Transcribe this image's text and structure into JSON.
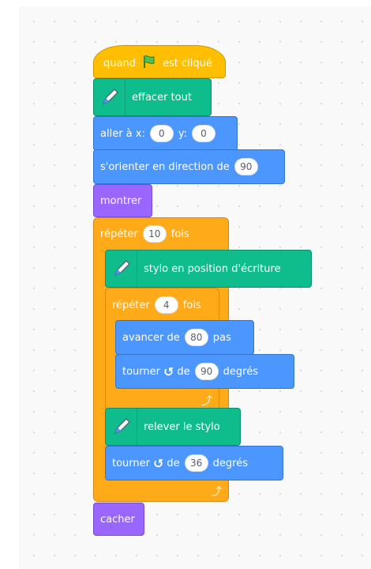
{
  "blocks": {
    "when_flag": {
      "prefix": "quand",
      "suffix": "est cliqué",
      "flag_icon": "green-flag-icon"
    },
    "clear": {
      "label": "effacer tout",
      "icon": "pen-icon"
    },
    "goto": {
      "label_x": "aller à x:",
      "x": "0",
      "label_y": "y:",
      "y": "0"
    },
    "point": {
      "label": "s'orienter en direction de",
      "value": "90"
    },
    "show": {
      "label": "montrer"
    },
    "repeat_outer": {
      "label": "répéter",
      "count": "10",
      "unit": "fois"
    },
    "pen_down": {
      "label": "stylo en position d'écriture",
      "icon": "pen-icon"
    },
    "repeat_inner": {
      "label": "répéter",
      "count": "4",
      "unit": "fois"
    },
    "move": {
      "label": "avancer de",
      "value": "80",
      "unit": "pas"
    },
    "turn_inner": {
      "label": "tourner",
      "glyph": "↺",
      "de": "de",
      "value": "90",
      "unit": "degrés"
    },
    "pen_up": {
      "label": "relever le stylo",
      "icon": "pen-icon"
    },
    "turn_outer": {
      "label": "tourner",
      "glyph": "↺",
      "de": "de",
      "value": "36",
      "unit": "degrés"
    },
    "loop_arrow": "⤴",
    "hide": {
      "label": "cacher"
    }
  },
  "colors": {
    "events": "#ffbf00",
    "control": "#ffab19",
    "motion": "#4c97ff",
    "looks": "#9966ff",
    "pen": "#0fbd8c"
  }
}
